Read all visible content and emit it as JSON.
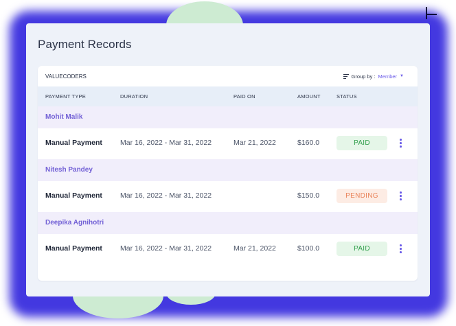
{
  "colors": {
    "accent": "#6a5be8",
    "backdrop": "#4338e0",
    "paid_text": "#2e9e49",
    "paid_bg": "#e5f6e8",
    "pending_text": "#e9835a",
    "pending_bg": "#fdece4",
    "group_bg": "#f1eefb"
  },
  "page": {
    "title": "Payment Records"
  },
  "card": {
    "org_name": "VALUECODERS",
    "group_by": {
      "icon": "filter-lines-icon",
      "label": "Group by :",
      "value": "Member",
      "caret_icon": "caret-down-icon"
    }
  },
  "table": {
    "columns": [
      "PAYMENT TYPE",
      "DURATION",
      "PAID ON",
      "AMOUNT",
      "STATUS"
    ],
    "groups": [
      {
        "member": "Mohit Malik",
        "rows": [
          {
            "payment_type": "Manual Payment",
            "duration": "Mar 16, 2022 - Mar 31, 2022",
            "paid_on": "Mar 21, 2022",
            "amount": "$160.0",
            "status": "PAID",
            "menu_icon": "kebab-menu-icon"
          }
        ]
      },
      {
        "member": "Nitesh Pandey",
        "rows": [
          {
            "payment_type": "Manual Payment",
            "duration": "Mar 16, 2022 - Mar 31, 2022",
            "paid_on": "",
            "amount": "$150.0",
            "status": "PENDING",
            "menu_icon": "kebab-menu-icon"
          }
        ]
      },
      {
        "member": "Deepika Agnihotri",
        "rows": [
          {
            "payment_type": "Manual Payment",
            "duration": "Mar 16, 2022 - Mar 31, 2022",
            "paid_on": "Mar 21, 2022",
            "amount": "$100.0",
            "status": "PAID",
            "menu_icon": "kebab-menu-icon"
          }
        ]
      }
    ]
  }
}
